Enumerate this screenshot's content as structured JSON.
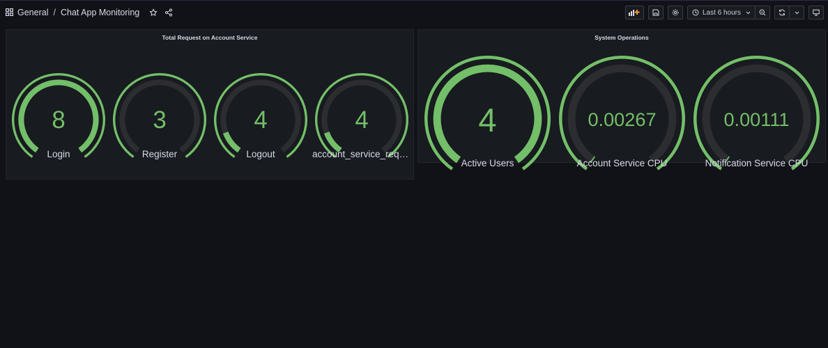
{
  "breadcrumb": {
    "folder": "General",
    "separator": "/",
    "dashboard": "Chat App Monitoring"
  },
  "toolbar": {
    "time_range": "Last 6 hours",
    "icons": [
      "add-panel-icon",
      "save-icon",
      "settings-icon",
      "clock-icon",
      "chevron-down-icon",
      "zoom-out-icon",
      "refresh-icon",
      "chevron-down-icon",
      "tv-mode-icon"
    ]
  },
  "colors": {
    "accent": "#73bf69",
    "track": "#2c2d31",
    "panel": "#181b1f",
    "background": "#111217"
  },
  "panels": [
    {
      "title": "Total Request on Account Service",
      "gauges": [
        {
          "label": "Login",
          "value": "8",
          "fill": 1.0
        },
        {
          "label": "Register",
          "value": "3",
          "fill": 0.0
        },
        {
          "label": "Logout",
          "value": "4",
          "fill": 0.12
        },
        {
          "label": "account_service_reque...",
          "value": "4",
          "fill": 0.12
        }
      ]
    },
    {
      "title": "System Operations",
      "gauges": [
        {
          "label": "Active Users",
          "value": "4",
          "fill": 1.0
        },
        {
          "label": "Account Service CPU",
          "value": "0.00267",
          "fill": 0.005
        },
        {
          "label": "Notification Service CPU",
          "value": "0.00111",
          "fill": 0.005
        }
      ]
    }
  ]
}
